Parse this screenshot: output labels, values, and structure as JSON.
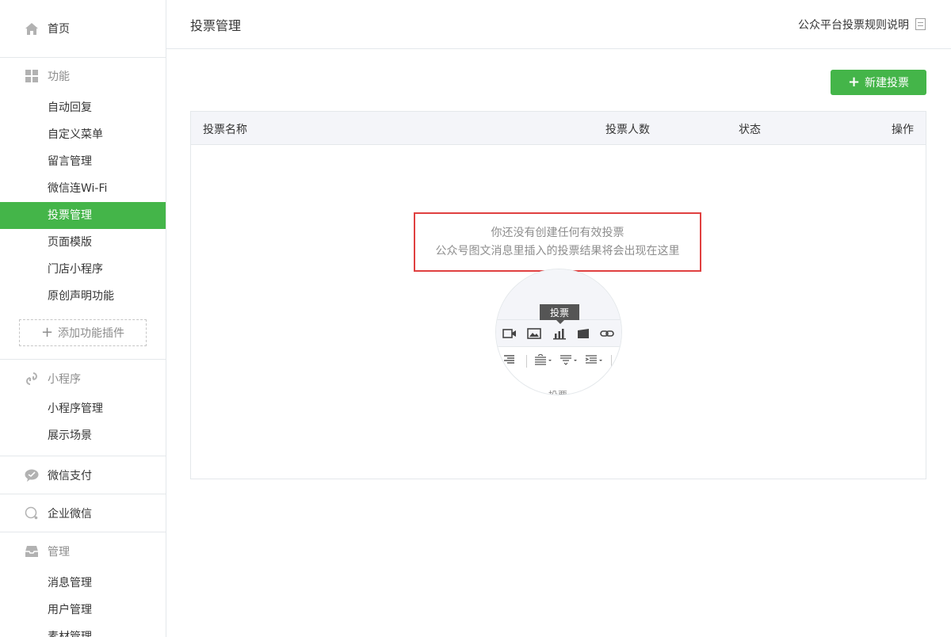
{
  "sidebar": {
    "home": "首页",
    "features": {
      "title": "功能",
      "items": [
        "自动回复",
        "自定义菜单",
        "留言管理",
        "微信连Wi-Fi",
        "投票管理",
        "页面模版",
        "门店小程序",
        "原创声明功能"
      ],
      "active_index": 4,
      "add_plugin": "添加功能插件"
    },
    "miniprogram": {
      "title": "小程序",
      "items": [
        "小程序管理",
        "展示场景"
      ]
    },
    "wechat_pay": "微信支付",
    "wecom": "企业微信",
    "manage": {
      "title": "管理",
      "items": [
        "消息管理",
        "用户管理",
        "素材管理"
      ]
    }
  },
  "header": {
    "title": "投票管理",
    "rules_link": "公众平台投票规则说明"
  },
  "toolbar": {
    "new_vote": "新建投票"
  },
  "table": {
    "columns": [
      "投票名称",
      "投票人数",
      "状态",
      "操作"
    ],
    "empty_line1": "你还没有创建任何有效投票",
    "empty_line2": "公众号图文消息里插入的投票结果将会出现在这里"
  },
  "illustration": {
    "tooltip": "投票",
    "cut_text": "投票"
  },
  "colors": {
    "accent": "#44b549",
    "highlight_border": "#e04040"
  }
}
